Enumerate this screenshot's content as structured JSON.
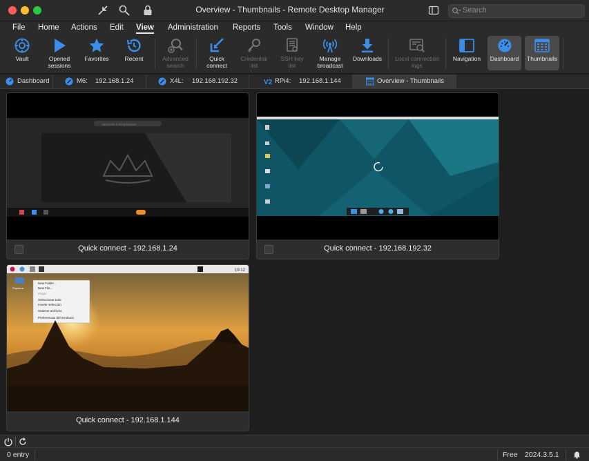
{
  "window": {
    "title": "Overview - Thumbnails - Remote Desktop Manager"
  },
  "search": {
    "placeholder": "Search"
  },
  "menu": [
    "File",
    "Home",
    "Actions",
    "Edit",
    "View",
    "Administration",
    "Reports",
    "Tools",
    "Window",
    "Help"
  ],
  "menu_active": "View",
  "ribbon": {
    "vault": "Vault",
    "opened_sessions": [
      "Opened",
      "sessions"
    ],
    "favorites": "Favorites",
    "recent": "Recent",
    "advanced_search": [
      "Advanced",
      "search"
    ],
    "quick_connect": [
      "Quick",
      "connect"
    ],
    "credential_list": [
      "Credential",
      "list"
    ],
    "ssh_key_list": [
      "SSH key",
      "list"
    ],
    "manage_broadcast": [
      "Manage",
      "broadcast"
    ],
    "downloads": "Downloads",
    "local_connection_logs": [
      "Local connection",
      "logs"
    ],
    "navigation": "Navigation",
    "dashboard": "Dashboard",
    "thumbnails": "Thumbnails"
  },
  "tabs": [
    {
      "label": "Dashboard",
      "host": ""
    },
    {
      "label": "M6:",
      "host": "192.168.1.24"
    },
    {
      "label": "X4L:",
      "host": "192.168.192.32"
    },
    {
      "label": "RPi4:",
      "host": "192.168.1.144"
    },
    {
      "label": "Overview - Thumbnails",
      "host": ""
    }
  ],
  "thumbnails": [
    {
      "caption": "Quick connect - 192.168.1.24"
    },
    {
      "caption": "Quick connect - 192.168.192.32"
    },
    {
      "caption": "Quick connect - 192.168.1.144"
    }
  ],
  "thumb1": {
    "search_text": "Search for a Thing Services"
  },
  "thumb3": {
    "clock": "19:12",
    "desktop_icon": "Papelera",
    "context_menu": [
      "New Folder...",
      "New File...",
      "Pegar",
      "Seleccionar todo",
      "Invertir selección",
      "Ordenar archivos",
      "Preferencias del escritorio"
    ]
  },
  "status": {
    "entries": "0 entry",
    "license": "Free",
    "version": "2024.3.5.1"
  },
  "colors": {
    "accent": "#3b8eea",
    "window_bg": "#2b2b2b",
    "content_bg": "#1e1e1e"
  }
}
